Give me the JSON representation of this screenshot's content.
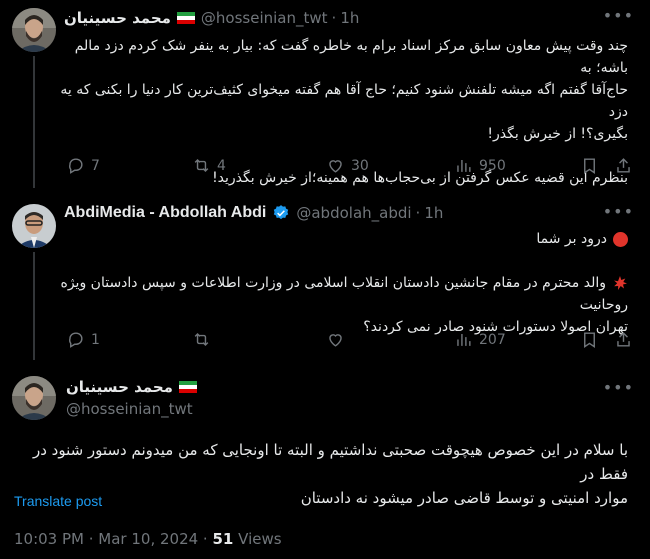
{
  "tweets": [
    {
      "display_name": "محمد حسينيان",
      "handle": "@hosseinian_twt",
      "time": "1h",
      "lines": [
        "چند وقت پیش معاون سابق مرکز اسناد برام به خاطره گفت که: بیار به ینفر شک کردم دزد مالم باشه؛ به",
        "حاج‌آقا گفتم اگه میشه تلفنش شنود کنیم؛ حاج آقا هم گفته میخوای کثیف‌ترین کار دنیا را بکنی که یه دزد",
        "بگیری؟! از خیرش بگذر!",
        "",
        "بنظرم این قضیه عکس گرفتن از بی‌حجاب‌ها هم همینه؛از خیرش بگذرید!"
      ],
      "replies": "7",
      "retweets": "4",
      "likes": "30",
      "views": "950"
    },
    {
      "display_name": "AbdiMedia - Abdollah Abdi",
      "handle": "@abdolah_abdi",
      "time": "1h",
      "greeting": "درود بر شما",
      "lines": [
        "والد محترم در مقام جانشین دادستان انقلاب اسلامی در وزارت اطلاعات و سپس دادستان ویژه روحانیت",
        "تهران اصولا دستورات شنود صادر نمی کردند؟"
      ],
      "replies": "1",
      "retweets": "",
      "likes": "",
      "views": "207"
    },
    {
      "display_name": "محمد حسينيان",
      "handle": "@hosseinian_twt",
      "lines": [
        "با سلام در این خصوص هیچوقت صحبتی نداشتیم و البته تا اونجایی که من میدونم دستور شنود در فقط در",
        "موارد امنیتی و توسط قاضی صادر میشود نه دادستان"
      ]
    }
  ],
  "translate_label": "Translate post",
  "timestamp": "10:03 PM · Mar 10, 2024 ·",
  "views_count": "51",
  "views_label": "Views",
  "colors": {
    "background": "#000000",
    "text": "#e7e9ea",
    "muted": "#71767b",
    "link": "#1d9bf0",
    "verified": "#1d9bf0"
  },
  "icons": [
    "reply-icon",
    "retweet-icon",
    "like-icon",
    "views-icon",
    "bookmark-icon",
    "share-icon",
    "more-icon",
    "verified-icon",
    "iran-flag-icon"
  ]
}
